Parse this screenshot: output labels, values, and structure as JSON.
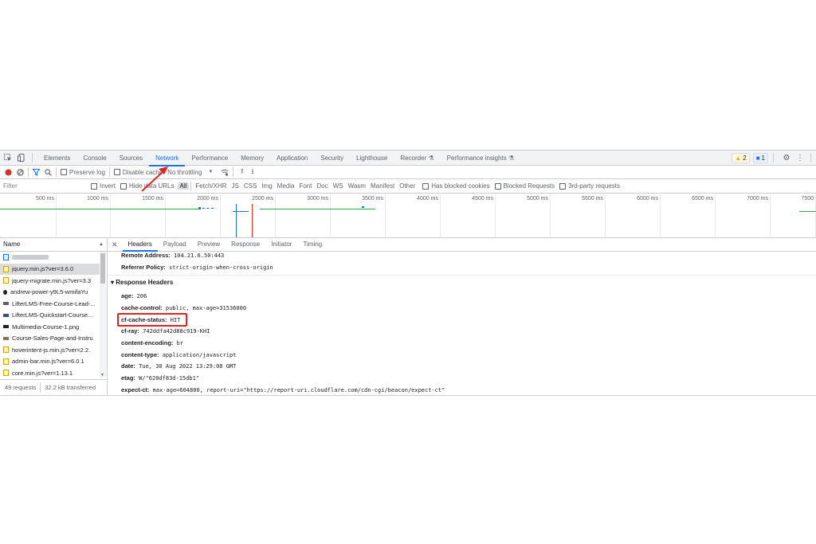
{
  "tabs": [
    "Elements",
    "Console",
    "Sources",
    "Network",
    "Performance",
    "Memory",
    "Application",
    "Security",
    "Lighthouse",
    "Recorder ⚗",
    "Performance insights ⚗"
  ],
  "active_tab": "Network",
  "badges": {
    "warnings": "2",
    "messages": "1"
  },
  "toolbar": {
    "preserve_log": "Preserve log",
    "disable_cache": "Disable cache",
    "throttling": "No throttling"
  },
  "filter": {
    "placeholder": "Filter",
    "invert": "Invert",
    "hide_data_urls": "Hide data URLs",
    "types": [
      "All",
      "Fetch/XHR",
      "JS",
      "CSS",
      "Img",
      "Media",
      "Font",
      "Doc",
      "WS",
      "Wasm",
      "Manifest",
      "Other"
    ],
    "has_blocked_cookies": "Has blocked cookies",
    "blocked_requests": "Blocked Requests",
    "third_party": "3rd-party requests"
  },
  "timeline_ticks": [
    "500 ms",
    "1000 ms",
    "1500 ms",
    "2000 ms",
    "2500 ms",
    "3000 ms",
    "3500 ms",
    "4000 ms",
    "4500 ms",
    "5000 ms",
    "5500 ms",
    "6000 ms",
    "6500 ms",
    "7000 ms",
    "7500"
  ],
  "requests": {
    "header": "Name",
    "items": [
      {
        "name": "",
        "type": "doc"
      },
      {
        "name": "jquery.min.js?ver=3.6.0",
        "type": "js"
      },
      {
        "name": "jquery-migrate.min.js?ver=3.3",
        "type": "js"
      },
      {
        "name": "andrew-power-y9L5-wmifaYu",
        "type": "dot"
      },
      {
        "name": "LifterLMS-Free-Course-Lead-...",
        "type": "img"
      },
      {
        "name": "LifterLMS-Quickstart-Course...",
        "type": "img"
      },
      {
        "name": "Multimedia-Course-1.png",
        "type": "img"
      },
      {
        "name": "Course-Sales-Page-and-Instru",
        "type": "img"
      },
      {
        "name": "hoverintent-js.min.js?ver=2.2.",
        "type": "js"
      },
      {
        "name": "admin-bar.min.js?ver=6.0.1",
        "type": "js"
      },
      {
        "name": "core.min.js?ver=1.13.1",
        "type": "js"
      }
    ],
    "selected_index": 1,
    "status_requests": "49 requests",
    "status_transferred": "32.2 kB transferred"
  },
  "detail_tabs": [
    "Headers",
    "Payload",
    "Preview",
    "Response",
    "Initiator",
    "Timing"
  ],
  "general": [
    {
      "key": "Remote Address:",
      "value": "104.21.6.50:443"
    },
    {
      "key": "Referrer Policy:",
      "value": "strict-origin-when-cross-origin"
    }
  ],
  "response_headers_title": "▾ Response Headers",
  "response_headers": [
    {
      "key": "age:",
      "value": "206"
    },
    {
      "key": "cache-control:",
      "value": "public, max-age=31536000"
    },
    {
      "key": "cf-cache-status:",
      "value": "HIT"
    },
    {
      "key": "cf-ray:",
      "value": "742ddfa42d88c919-KHI"
    },
    {
      "key": "content-encoding:",
      "value": "br"
    },
    {
      "key": "content-type:",
      "value": "application/javascript"
    },
    {
      "key": "date:",
      "value": "Tue, 30 Aug 2022 13:29:08 GMT"
    },
    {
      "key": "etag:",
      "value": "W/\"620df83d-15db1\""
    },
    {
      "key": "expect-ct:",
      "value": "max-age=604800, report-uri=\"https://report-uri.cloudflare.com/cdn-cgi/beacon/expect-ct\""
    }
  ],
  "colors": {
    "accent": "#1a73e8",
    "highlight": "#e02424",
    "record": "#d93025"
  }
}
